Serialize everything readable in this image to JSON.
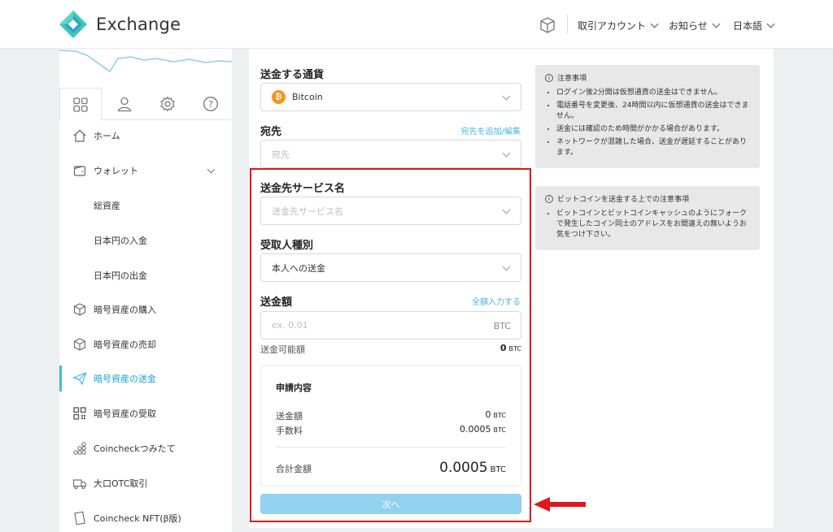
{
  "header": {
    "brand": "Exchange",
    "menu": [
      {
        "label": "取引アカウント"
      },
      {
        "label": "お知らせ"
      },
      {
        "label": "日本語"
      }
    ]
  },
  "sidebar": {
    "items": [
      {
        "label": "ホーム",
        "icon": "home-icon"
      },
      {
        "label": "ウォレット",
        "icon": "wallet-icon"
      },
      {
        "label": "総資産"
      },
      {
        "label": "日本円の入金"
      },
      {
        "label": "日本円の出金"
      },
      {
        "label": "暗号資産の購入",
        "icon": "cube-icon"
      },
      {
        "label": "暗号資産の売却",
        "icon": "cube-icon"
      },
      {
        "label": "暗号資産の送金",
        "icon": "send-icon",
        "active": true
      },
      {
        "label": "暗号資産の受取",
        "icon": "qr-code-icon"
      },
      {
        "label": "Coincheckつみたて",
        "icon": "coins-icon"
      },
      {
        "label": "大口OTC取引",
        "icon": "truck-icon"
      },
      {
        "label": "Coincheck NFT(β版)",
        "icon": "card-icon"
      }
    ]
  },
  "form": {
    "currency": {
      "label": "送金する通貨",
      "value": "Bitcoin",
      "badge": "₿"
    },
    "destination": {
      "label": "宛先",
      "link": "宛先を追加/編集",
      "placeholder": "宛先"
    },
    "service": {
      "label": "送金先サービス名",
      "placeholder": "送金先サービス名"
    },
    "recipient_type": {
      "label": "受取人種別",
      "value": "本人への送金"
    },
    "amount": {
      "label": "送金額",
      "link": "全額入力する",
      "placeholder": "ex. 0.01",
      "unit": "BTC"
    },
    "available": {
      "label": "送金可能額",
      "value": "0",
      "unit": "BTC"
    },
    "summary": {
      "title": "申請内容",
      "amount_label": "送金額",
      "amount_value": "0",
      "amount_unit": "BTC",
      "fee_label": "手数料",
      "fee_value": "0.0005",
      "fee_unit": "BTC",
      "total_label": "合計金額",
      "total_value": "0.0005",
      "total_unit": "BTC"
    },
    "next_button": "次へ"
  },
  "notices": [
    {
      "title": "注意事項",
      "items": [
        "ログイン後2分間は仮想通貨の送金はできません。",
        "電話番号を変更後、24時間以内に仮想通貨の送金はできません。",
        "送金には確認のため時間がかかる場合があります。",
        "ネットワークが混雑した場合、送金が遅延することがあります。"
      ]
    },
    {
      "title": "ビットコインを送金する上での注意事項",
      "items": [
        "ビットコインとビットコインキャッシュのようにフォークで発生したコイン同士のアドレスをお間違えの無いようお気をつけ下さい。"
      ]
    }
  ],
  "colors": {
    "accent": "#49b5e6",
    "highlight": "#e0161c",
    "button": "#92d2f0",
    "bitcoin": "#f7931a"
  }
}
